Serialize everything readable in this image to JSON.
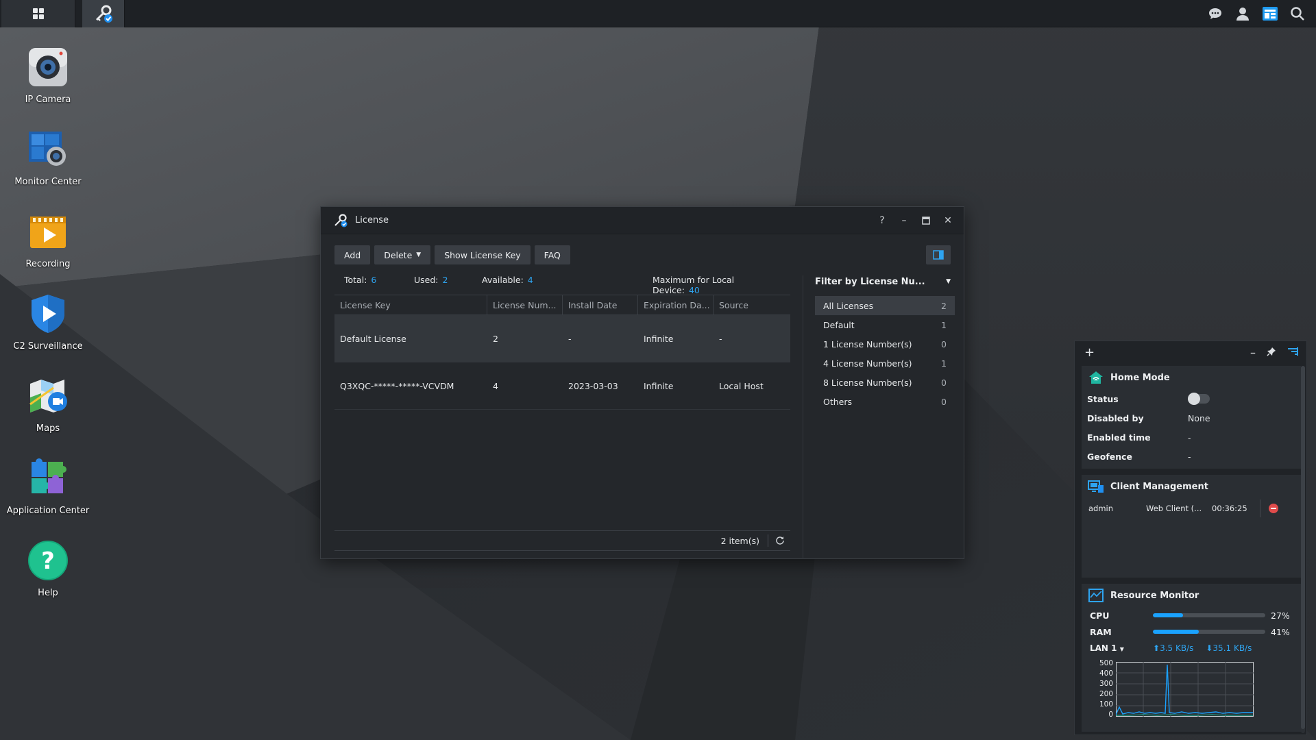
{
  "desktop": {
    "icons": [
      {
        "label": "IP Camera",
        "icon": "ip-camera-icon"
      },
      {
        "label": "Monitor Center",
        "icon": "monitor-center-icon"
      },
      {
        "label": "Recording",
        "icon": "recording-icon"
      },
      {
        "label": "C2 Surveillance",
        "icon": "c2-surveillance-icon"
      },
      {
        "label": "Maps",
        "icon": "maps-icon"
      },
      {
        "label": "Application Center",
        "icon": "application-center-icon"
      },
      {
        "label": "Help",
        "icon": "help-icon"
      }
    ]
  },
  "window": {
    "title": "License",
    "controls": {
      "help": "?",
      "minimize": "–",
      "maximize": "▭",
      "close": "✕"
    },
    "toolbar": {
      "add": "Add",
      "delete": "Delete",
      "show_key": "Show License Key",
      "faq": "FAQ"
    },
    "stats": {
      "total_label": "Total:",
      "total_value": "6",
      "used_label": "Used:",
      "used_value": "2",
      "available_label": "Available:",
      "available_value": "4",
      "max_label": "Maximum for Local Device:",
      "max_value": "40"
    },
    "table": {
      "columns": [
        "License Key",
        "License Num...",
        "Install Date",
        "Expiration Da...",
        "Source"
      ],
      "rows": [
        {
          "key": "Default License",
          "num": "2",
          "install": "-",
          "expiration": "Infinite",
          "source": "-"
        },
        {
          "key": "Q3XQC-*****-*****-VCVDM",
          "num": "4",
          "install": "2023-03-03",
          "expiration": "Infinite",
          "source": "Local Host"
        }
      ],
      "footer_count": "2 item(s)"
    },
    "filter": {
      "title": "Filter by License Nu...",
      "items": [
        {
          "label": "All Licenses",
          "count": "2"
        },
        {
          "label": "Default",
          "count": "1"
        },
        {
          "label": "1 License Number(s)",
          "count": "0"
        },
        {
          "label": "4 License Number(s)",
          "count": "1"
        },
        {
          "label": "8 License Number(s)",
          "count": "0"
        },
        {
          "label": "Others",
          "count": "0"
        }
      ]
    }
  },
  "widgets": {
    "top": {
      "add": "+",
      "minimize": "–"
    },
    "home_mode": {
      "title": "Home Mode",
      "status_label": "Status",
      "disabled_by_label": "Disabled by",
      "disabled_by_value": "None",
      "enabled_time_label": "Enabled time",
      "enabled_time_value": "-",
      "geofence_label": "Geofence",
      "geofence_value": "-"
    },
    "client_management": {
      "title": "Client Management",
      "user": "admin",
      "client": "Web Client (...",
      "time": "00:36:25"
    },
    "resource_monitor": {
      "title": "Resource Monitor",
      "cpu_label": "CPU",
      "cpu_value": "27%",
      "cpu_fraction": 0.27,
      "ram_label": "RAM",
      "ram_value": "41%",
      "ram_fraction": 0.41,
      "lan_label": "LAN 1",
      "upload": "3.5 KB/s",
      "download": "35.1 KB/s",
      "chart_ticks": [
        "500",
        "400",
        "300",
        "200",
        "100",
        "0"
      ]
    }
  },
  "colors": {
    "accent": "#2ea4f0",
    "bar_fill": "#1aa2ff",
    "kick": "#e04b4b"
  }
}
